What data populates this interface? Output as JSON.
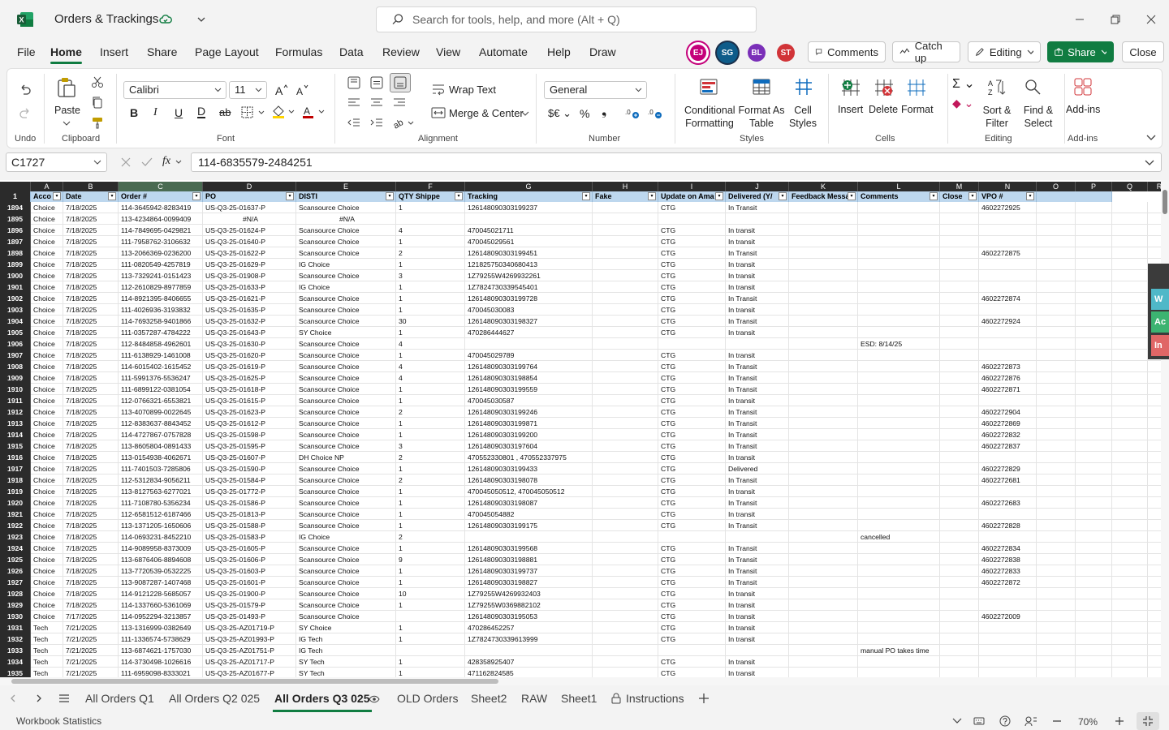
{
  "app": {
    "doc_title": "Orders & Trackings",
    "search_placeholder": "Search for tools, help, and more (Alt + Q)"
  },
  "menu": [
    "File",
    "Home",
    "Insert",
    "Share",
    "Page Layout",
    "Formulas",
    "Data",
    "Review",
    "View",
    "Automate",
    "Help",
    "Draw"
  ],
  "avatars": [
    {
      "initials": "EJ",
      "color": "#c4007a"
    },
    {
      "initials": "SG",
      "color": "#0e5c8a"
    },
    {
      "initials": "BL",
      "color": "#7a2fb8"
    },
    {
      "initials": "ST",
      "color": "#d13438"
    }
  ],
  "top_buttons": {
    "comments": "Comments",
    "catchup": "Catch up",
    "editing": "Editing",
    "share": "Share",
    "close": "Close"
  },
  "ribbon": {
    "undo_label": "Undo",
    "paste": "Paste",
    "clipboard": "Clipboard",
    "font_name": "Calibri",
    "font_size": "11",
    "font": "Font",
    "wrap_text": "Wrap Text",
    "merge_center": "Merge & Center",
    "alignment": "Alignment",
    "number_format": "General",
    "number": "Number",
    "conditional_formatting": "Conditional Formatting",
    "format_as_table": "Format As Table",
    "cell_styles": "Cell Styles",
    "styles": "Styles",
    "insert": "Insert",
    "delete": "Delete",
    "format": "Format",
    "cells": "Cells",
    "sort_filter": "Sort & Filter",
    "find_select": "Find & Select",
    "editing": "Editing",
    "addins": "Add-ins",
    "addins_group": "Add-ins"
  },
  "formula_bar": {
    "name_box": "C1727",
    "formula": "114-6835579-2484251"
  },
  "columns": [
    "A",
    "B",
    "C",
    "D",
    "E",
    "F",
    "G",
    "H",
    "I",
    "J",
    "K",
    "L",
    "M",
    "N",
    "O",
    "P",
    "Q",
    "R"
  ],
  "headers": [
    "Acco",
    "Date",
    "Order #",
    "PO",
    "DISTI",
    "QTY Shippe",
    "Tracking",
    "Fake",
    "Update on Ama",
    "Delivered (Y/",
    "Feedback Messa",
    "Comments",
    "Close",
    "VPO #"
  ],
  "rows": [
    [
      "1894",
      "Choice",
      "7/18/2025",
      "114-3645942-8283419",
      "US-Q3-25-01637-P",
      "Scansource Choice",
      "1",
      "126148090303199237",
      "",
      "CTG",
      "In Transit",
      "",
      "",
      "",
      "4602272925"
    ],
    [
      "1895",
      "Choice",
      "7/18/2025",
      "113-4234864-0099409",
      "#N/A",
      "#N/A",
      "",
      "",
      "",
      "",
      "",
      "",
      "",
      "",
      ""
    ],
    [
      "1896",
      "Choice",
      "7/18/2025",
      "114-7849695-0429821",
      "US-Q3-25-01624-P",
      "Scansource Choice",
      "4",
      "470045021711",
      "",
      "CTG",
      "In transit",
      "",
      "",
      "",
      ""
    ],
    [
      "1897",
      "Choice",
      "7/18/2025",
      "111-7958762-3106632",
      "US-Q3-25-01640-P",
      "Scansource Choice",
      "1",
      "470045029561",
      "",
      "CTG",
      "In transit",
      "",
      "",
      "",
      ""
    ],
    [
      "1898",
      "Choice",
      "7/18/2025",
      "113-2066369-0236200",
      "US-Q3-25-01622-P",
      "Scansource Choice",
      "2",
      "126148090303199451",
      "",
      "CTG",
      "In Transit",
      "",
      "",
      "",
      "4602272875"
    ],
    [
      "1899",
      "Choice",
      "7/18/2025",
      "111-0820549-4257819",
      "US-Q3-25-01629-P",
      "IG Choice",
      "1",
      "121825750340680413",
      "",
      "CTG",
      "In transit",
      "",
      "",
      "",
      ""
    ],
    [
      "1900",
      "Choice",
      "7/18/2025",
      "113-7329241-0151423",
      "US-Q3-25-01908-P",
      "Scansource Choice",
      "3",
      "1Z79255W4269932261",
      "",
      "CTG",
      "In transit",
      "",
      "",
      "",
      ""
    ],
    [
      "1901",
      "Choice",
      "7/18/2025",
      "112-2610829-8977859",
      "US-Q3-25-01633-P",
      "IG Choice",
      "1",
      "1Z7824730339545401",
      "",
      "CTG",
      "In transit",
      "",
      "",
      "",
      ""
    ],
    [
      "1902",
      "Choice",
      "7/18/2025",
      "114-8921395-8406655",
      "US-Q3-25-01621-P",
      "Scansource Choice",
      "1",
      "126148090303199728",
      "",
      "CTG",
      "In Transit",
      "",
      "",
      "",
      "4602272874"
    ],
    [
      "1903",
      "Choice",
      "7/18/2025",
      "111-4026936-3193832",
      "US-Q3-25-01635-P",
      "Scansource Choice",
      "1",
      "470045030083",
      "",
      "CTG",
      "In transit",
      "",
      "",
      "",
      ""
    ],
    [
      "1904",
      "Choice",
      "7/18/2025",
      "114-7693258-9401866",
      "US-Q3-25-01632-P",
      "Scansource Choice",
      "30",
      "126148090303198327",
      "",
      "CTG",
      "In Transit",
      "",
      "",
      "",
      "4602272924"
    ],
    [
      "1905",
      "Choice",
      "7/18/2025",
      "111-0357287-4784222",
      "US-Q3-25-01643-P",
      "SY Choice",
      "1",
      "470286444627",
      "",
      "CTG",
      "In transit",
      "",
      "",
      "",
      ""
    ],
    [
      "1906",
      "Choice",
      "7/18/2025",
      "112-8484858-4962601",
      "US-Q3-25-01630-P",
      "Scansource Choice",
      "4",
      "",
      "",
      "",
      "",
      "",
      "ESD: 8/14/25",
      "",
      ""
    ],
    [
      "1907",
      "Choice",
      "7/18/2025",
      "111-6138929-1461008",
      "US-Q3-25-01620-P",
      "Scansource Choice",
      "1",
      "470045029789",
      "",
      "CTG",
      "In transit",
      "",
      "",
      "",
      ""
    ],
    [
      "1908",
      "Choice",
      "7/18/2025",
      "114-6015402-1615452",
      "US-Q3-25-01619-P",
      "Scansource Choice",
      "4",
      "126148090303199764",
      "",
      "CTG",
      "In Transit",
      "",
      "",
      "",
      "4602272873"
    ],
    [
      "1909",
      "Choice",
      "7/18/2025",
      "111-5991376-5536247",
      "US-Q3-25-01625-P",
      "Scansource Choice",
      "4",
      "126148090303198854",
      "",
      "CTG",
      "In Transit",
      "",
      "",
      "",
      "4602272876"
    ],
    [
      "1910",
      "Choice",
      "7/18/2025",
      "111-6899122-0381054",
      "US-Q3-25-01618-P",
      "Scansource Choice",
      "1",
      "126148090303199559",
      "",
      "CTG",
      "In Transit",
      "",
      "",
      "",
      "4602272871"
    ],
    [
      "1911",
      "Choice",
      "7/18/2025",
      "112-0766321-6553821",
      "US-Q3-25-01615-P",
      "Scansource Choice",
      "1",
      "470045030587",
      "",
      "CTG",
      "In transit",
      "",
      "",
      "",
      ""
    ],
    [
      "1912",
      "Choice",
      "7/18/2025",
      "113-4070899-0022645",
      "US-Q3-25-01623-P",
      "Scansource Choice",
      "2",
      "126148090303199246",
      "",
      "CTG",
      "In Transit",
      "",
      "",
      "",
      "4602272904"
    ],
    [
      "1913",
      "Choice",
      "7/18/2025",
      "112-8383637-8843452",
      "US-Q3-25-01612-P",
      "Scansource Choice",
      "1",
      "126148090303199871",
      "",
      "CTG",
      "In Transit",
      "",
      "",
      "",
      "4602272869"
    ],
    [
      "1914",
      "Choice",
      "7/18/2025",
      "114-4727867-0757828",
      "US-Q3-25-01598-P",
      "Scansource Choice",
      "1",
      "126148090303199200",
      "",
      "CTG",
      "In Transit",
      "",
      "",
      "",
      "4602272832"
    ],
    [
      "1915",
      "Choice",
      "7/18/2025",
      "113-8605804-0891433",
      "US-Q3-25-01595-P",
      "Scansource Choice",
      "3",
      "126148090303197604",
      "",
      "CTG",
      "In Transit",
      "",
      "",
      "",
      "4602272837"
    ],
    [
      "1916",
      "Choice",
      "7/18/2025",
      "113-0154938-4062671",
      "US-Q3-25-01607-P",
      "DH Choice NP",
      "2",
      "470552330801 , 470552337975",
      "",
      "CTG",
      "In transit",
      "",
      "",
      "",
      ""
    ],
    [
      "1917",
      "Choice",
      "7/18/2025",
      "111-7401503-7285806",
      "US-Q3-25-01590-P",
      "Scansource Choice",
      "1",
      "126148090303199433",
      "",
      "CTG",
      "Delivered",
      "",
      "",
      "",
      "4602272829"
    ],
    [
      "1918",
      "Choice",
      "7/18/2025",
      "112-5312834-9056211",
      "US-Q3-25-01584-P",
      "Scansource Choice",
      "2",
      "126148090303198078",
      "",
      "CTG",
      "In Transit",
      "",
      "",
      "",
      "4602272681"
    ],
    [
      "1919",
      "Choice",
      "7/18/2025",
      "113-8127563-6277021",
      "US-Q3-25-01772-P",
      "Scansource Choice",
      "1",
      "470045050512, 470045050512",
      "",
      "CTG",
      "In transit",
      "",
      "",
      "",
      ""
    ],
    [
      "1920",
      "Choice",
      "7/18/2025",
      "111-7108780-5356234",
      "US-Q3-25-01586-P",
      "Scansource Choice",
      "1",
      "126148090303198087",
      "",
      "CTG",
      "In Transit",
      "",
      "",
      "",
      "4602272683"
    ],
    [
      "1921",
      "Choice",
      "7/18/2025",
      "112-6581512-6187466",
      "US-Q3-25-01813-P",
      "Scansource Choice",
      "1",
      "470045054882",
      "",
      "CTG",
      "In transit",
      "",
      "",
      "",
      ""
    ],
    [
      "1922",
      "Choice",
      "7/18/2025",
      "113-1371205-1650606",
      "US-Q3-25-01588-P",
      "Scansource Choice",
      "1",
      "126148090303199175",
      "",
      "CTG",
      "In Transit",
      "",
      "",
      "",
      "4602272828"
    ],
    [
      "1923",
      "Choice",
      "7/18/2025",
      "114-0693231-8452210",
      "US-Q3-25-01583-P",
      "IG Choice",
      "2",
      "",
      "",
      "",
      "",
      "",
      "cancelled",
      "",
      ""
    ],
    [
      "1924",
      "Choice",
      "7/18/2025",
      "114-9089958-8373009",
      "US-Q3-25-01605-P",
      "Scansource Choice",
      "1",
      "126148090303199568",
      "",
      "CTG",
      "In Transit",
      "",
      "",
      "",
      "4602272834"
    ],
    [
      "1925",
      "Choice",
      "7/18/2025",
      "113-6876406-8894608",
      "US-Q3-25-01606-P",
      "Scansource Choice",
      "9",
      "126148090303198881",
      "",
      "CTG",
      "In Transit",
      "",
      "",
      "",
      "4602272838"
    ],
    [
      "1926",
      "Choice",
      "7/18/2025",
      "113-7720539-0532225",
      "US-Q3-25-01603-P",
      "Scansource Choice",
      "1",
      "126148090303199737",
      "",
      "CTG",
      "In Transit",
      "",
      "",
      "",
      "4602272833"
    ],
    [
      "1927",
      "Choice",
      "7/18/2025",
      "113-9087287-1407468",
      "US-Q3-25-01601-P",
      "Scansource Choice",
      "1",
      "126148090303198827",
      "",
      "CTG",
      "In Transit",
      "",
      "",
      "",
      "4602272872"
    ],
    [
      "1928",
      "Choice",
      "7/18/2025",
      "114-9121228-5685057",
      "US-Q3-25-01900-P",
      "Scansource Choice",
      "10",
      "1Z79255W4269932403",
      "",
      "CTG",
      "In transit",
      "",
      "",
      "",
      ""
    ],
    [
      "1929",
      "Choice",
      "7/18/2025",
      "114-1337660-5361069",
      "US-Q3-25-01579-P",
      "Scansource Choice",
      "1",
      "1Z79255W0369882102",
      "",
      "CTG",
      "In transit",
      "",
      "",
      "",
      ""
    ],
    [
      "1930",
      "Choice",
      "7/17/2025",
      "114-0952294-3213857",
      "US-Q3-25-01493-P",
      "Scansource Choice",
      "",
      "126148090303195053",
      "",
      "CTG",
      "In transit",
      "",
      "",
      "",
      "4602272009"
    ],
    [
      "1931",
      "Tech",
      "7/21/2025",
      "113-1316999-0382649",
      "US-Q3-25-AZ01719-P",
      "SY Choice",
      "1",
      "470286452257",
      "",
      "CTG",
      "In transit",
      "",
      "",
      "",
      ""
    ],
    [
      "1932",
      "Tech",
      "7/21/2025",
      "111-1336574-5738629",
      "US-Q3-25-AZ01993-P",
      "IG Tech",
      "1",
      "1Z7824730339613999",
      "",
      "CTG",
      "In transit",
      "",
      "",
      "",
      ""
    ],
    [
      "1933",
      "Tech",
      "7/21/2025",
      "113-6874621-1757030",
      "US-Q3-25-AZ01751-P",
      "IG Tech",
      "",
      "",
      "",
      "",
      "",
      "",
      "manual PO takes time",
      "",
      ""
    ],
    [
      "1934",
      "Tech",
      "7/21/2025",
      "114-3730498-1026616",
      "US-Q3-25-AZ01717-P",
      "SY Tech",
      "1",
      "428358925407",
      "",
      "CTG",
      "In transit",
      "",
      "",
      "",
      ""
    ],
    [
      "1935",
      "Tech",
      "7/21/2025",
      "111-6959098-8333021",
      "US-Q3-25-AZ01677-P",
      "SY Tech",
      "1",
      "471162824585",
      "",
      "CTG",
      "In transit",
      "",
      "",
      "",
      ""
    ]
  ],
  "side_tabs": [
    "W",
    "Ac",
    "In"
  ],
  "sheet_tabs": [
    "All Orders Q1",
    "All Orders Q2 025",
    "All Orders Q3 025",
    "OLD Orders",
    "Sheet2",
    "RAW",
    "Sheet1",
    "Instructions"
  ],
  "status": {
    "workbook_stats": "Workbook Statistics",
    "zoom": "70%"
  }
}
